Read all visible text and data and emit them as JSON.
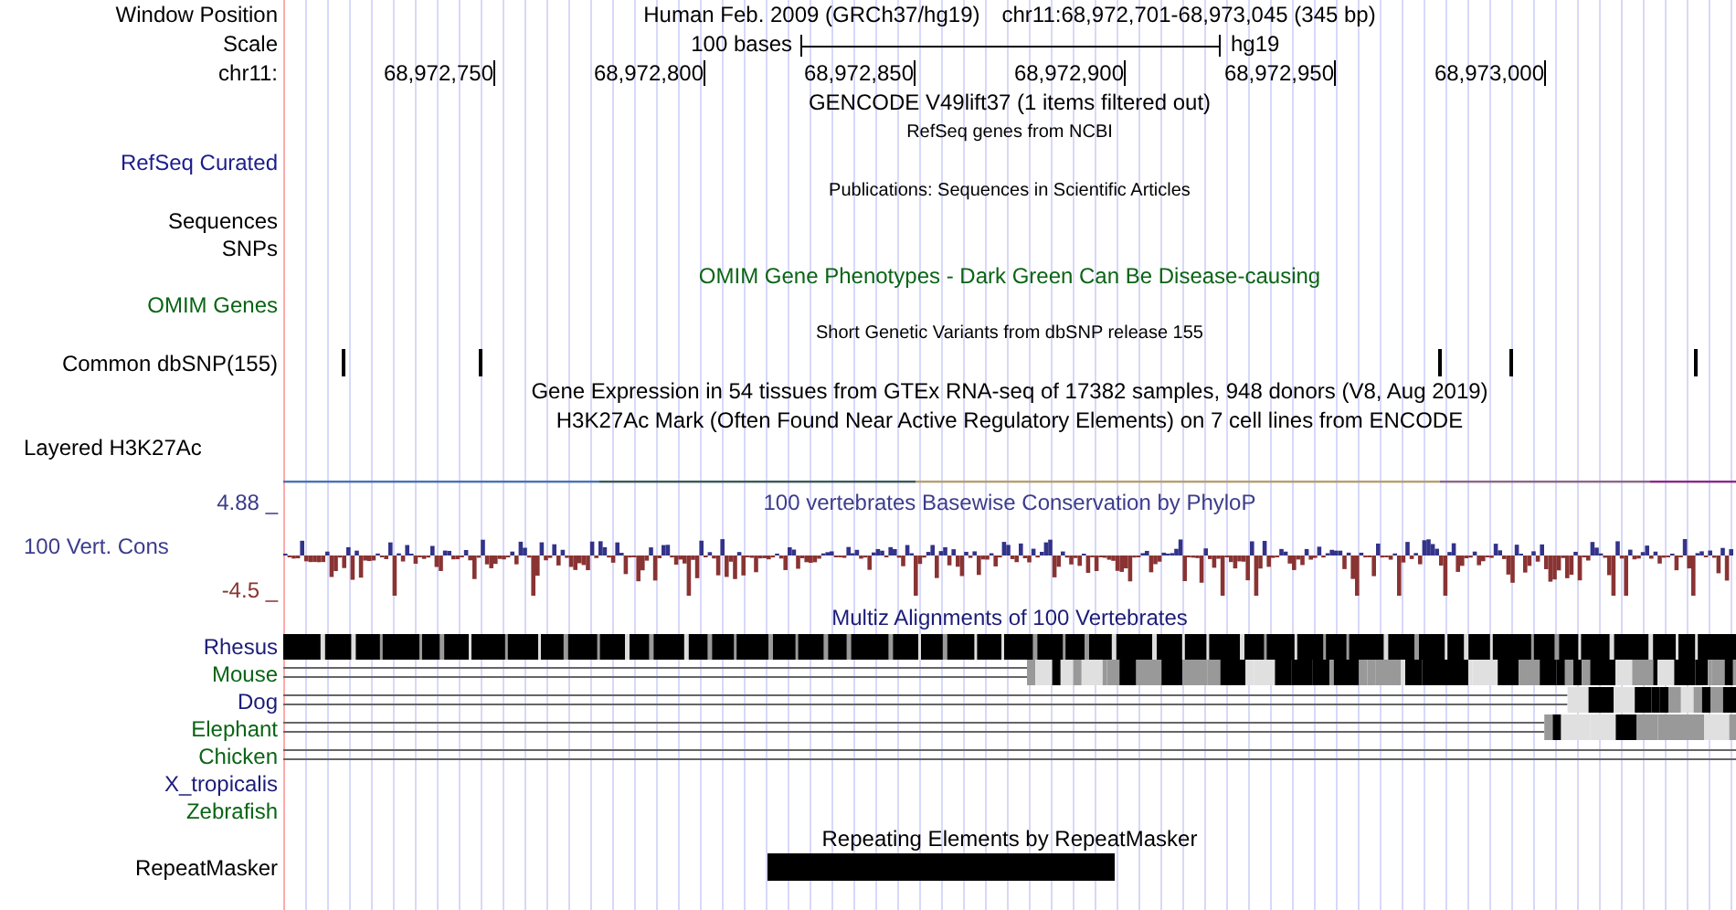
{
  "header": {
    "label": "Window Position",
    "assembly": "Human Feb. 2009 (GRCh37/hg19)",
    "position": "chr11:68,972,701-68,973,045 (345 bp)"
  },
  "scale": {
    "label": "Scale",
    "bar_text": "100 bases",
    "assembly": "hg19"
  },
  "ruler": {
    "label": "chr11:",
    "ticks": [
      "68,972,750",
      "68,972,800",
      "68,972,850",
      "68,972,900",
      "68,972,950",
      "68,973,000"
    ]
  },
  "tracks": [
    {
      "kind": "title",
      "text": "GENCODE V49lift37 (1 items filtered out)",
      "color": "#000000"
    },
    {
      "kind": "note",
      "text": "RefSeq genes from NCBI"
    },
    {
      "kind": "label",
      "label": "RefSeq Curated",
      "color": "#1c1c8c"
    },
    {
      "kind": "note",
      "text": "Publications: Sequences in Scientific Articles"
    },
    {
      "kind": "label",
      "label": "Sequences",
      "color": "#000000"
    },
    {
      "kind": "label",
      "label": "SNPs",
      "color": "#000000"
    },
    {
      "kind": "title",
      "text": "OMIM Gene Phenotypes - Dark Green Can Be Disease-causing",
      "color": "#0a6414"
    },
    {
      "kind": "label",
      "label": "OMIM Genes",
      "color": "#0a6414"
    },
    {
      "kind": "note",
      "text": "Short Genetic Variants from dbSNP release 155"
    },
    {
      "kind": "variants",
      "label": "Common dbSNP(155)"
    },
    {
      "kind": "title",
      "text": "Gene Expression in 54 tissues from GTEx RNA-seq of 17382 samples, 948 donors (V8, Aug 2019)",
      "color": "#000000"
    },
    {
      "kind": "title",
      "text": "H3K27Ac Mark (Often Found Near Active Regulatory Elements) on 7 cell lines from ENCODE",
      "color": "#000000"
    },
    {
      "kind": "signal",
      "label": "Layered H3K27Ac"
    },
    {
      "kind": "conservation",
      "title": "100 vertebrates Basewise Conservation by PhyloP",
      "label": "100 Vert. Cons",
      "max": "4.88 _",
      "min": "-4.5 _"
    },
    {
      "kind": "title",
      "text": "Multiz Alignments of 100 Vertebrates",
      "color": "#1c1c78"
    },
    {
      "kind": "alignment",
      "label": "Rhesus",
      "color": "#1c1c78",
      "alignment": {
        "kind": "dense"
      }
    },
    {
      "kind": "alignment",
      "label": "Mouse",
      "color": "#0a6414",
      "alignment": {
        "kind": "partial"
      }
    },
    {
      "kind": "alignment",
      "label": "Dog",
      "color": "#1c1c78",
      "alignment": {
        "kind": "partial"
      }
    },
    {
      "kind": "alignment",
      "label": "Elephant",
      "color": "#0a6414",
      "alignment": {
        "kind": "partial"
      }
    },
    {
      "kind": "alignment",
      "label": "Chicken",
      "color": "#0a6414",
      "alignment": {
        "kind": "lines"
      }
    },
    {
      "kind": "alignment",
      "label": "X_tropicalis",
      "color": "#1c1c78"
    },
    {
      "kind": "alignment",
      "label": "Zebrafish",
      "color": "#0a6414"
    },
    {
      "kind": "title",
      "text": "Repeating Elements by RepeatMasker",
      "color": "#000000"
    },
    {
      "kind": "repeat",
      "label": "RepeatMasker"
    }
  ]
}
